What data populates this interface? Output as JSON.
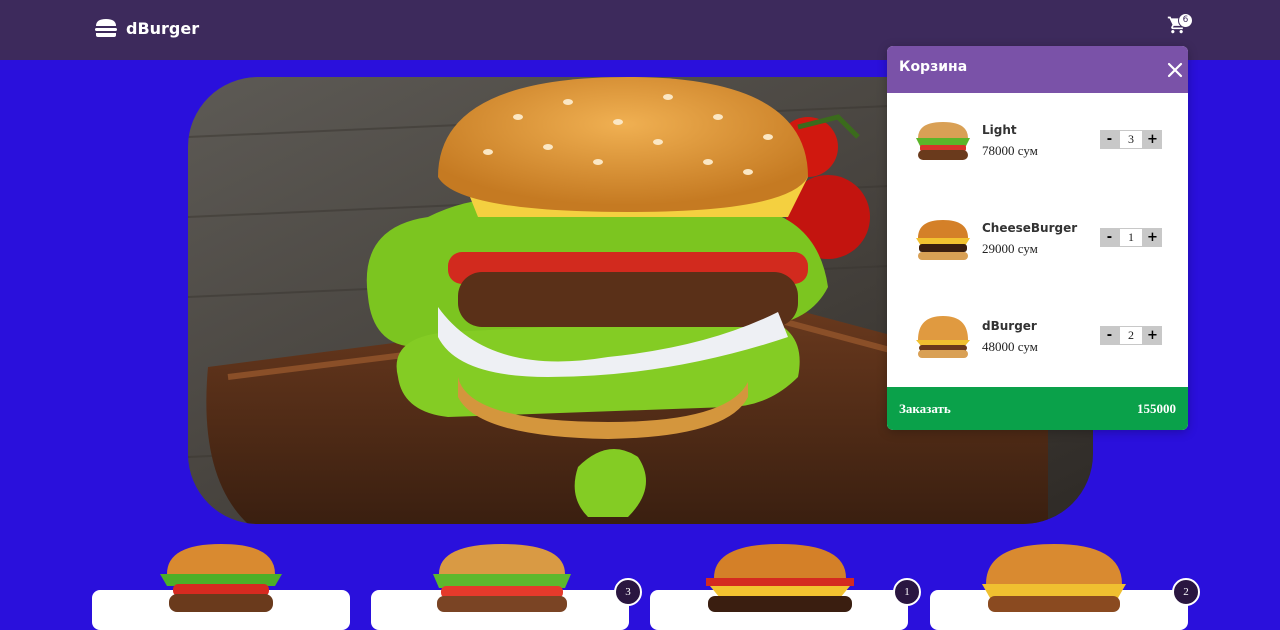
{
  "header": {
    "brand": "dBurger",
    "cart_count": "6"
  },
  "cart": {
    "title": "Корзина",
    "items": [
      {
        "name": "Light",
        "price": "78000 сум",
        "qty": "3"
      },
      {
        "name": "CheeseBurger",
        "price": "29000 сум",
        "qty": "1"
      },
      {
        "name": "dBurger",
        "price": "48000 сум",
        "qty": "2"
      }
    ],
    "minus": "-",
    "plus": "+",
    "order_label": "Заказать",
    "total": "155000"
  },
  "products": {
    "badges": [
      "3",
      "1",
      "2"
    ]
  },
  "colors": {
    "background": "#2a10dc",
    "header": "#3d2a5c",
    "cart_header": "#7a52a8",
    "order_bar": "#0aa14a"
  }
}
